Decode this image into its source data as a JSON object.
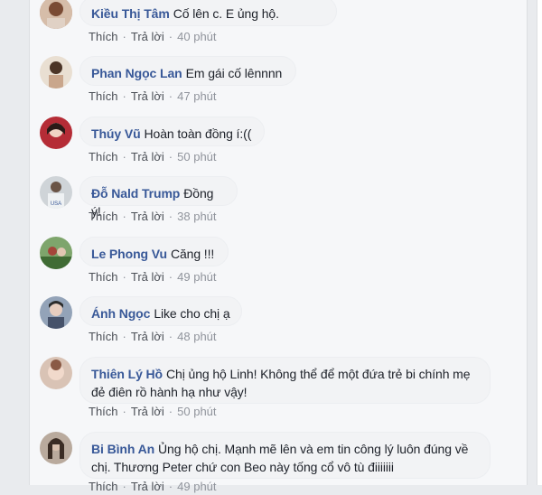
{
  "comments": [
    {
      "name": "Kiều Thị Tâm",
      "text": "Cố lên c. E ủng hộ.",
      "like": "Thích",
      "reply": "Trả lời",
      "time": "40 phút",
      "avatar_color": "#b7866d"
    },
    {
      "name": "Phan Ngọc Lan",
      "text": "Em gái cố lênnnn",
      "like": "Thích",
      "reply": "Trả lời",
      "time": "47 phút",
      "avatar_color": "#8b6a55"
    },
    {
      "name": "Thúy Vũ",
      "text": "Hoàn toàn đồng í:((",
      "like": "Thích",
      "reply": "Trả lời",
      "time": "50 phút",
      "avatar_color": "#a42b33"
    },
    {
      "name": "Đỗ Nald Trump",
      "text": "Đồng ý!",
      "like": "Thích",
      "reply": "Trả lời",
      "time": "38 phút",
      "avatar_color": "#6f7d88"
    },
    {
      "name": "Le Phong Vu",
      "text": "Căng !!!",
      "like": "Thích",
      "reply": "Trả lời",
      "time": "49 phút",
      "avatar_color": "#4e7a4a"
    },
    {
      "name": "Ánh Ngọc",
      "text": "Like cho chị ạ",
      "like": "Thích",
      "reply": "Trả lời",
      "time": "48 phút",
      "avatar_color": "#5c6b82"
    },
    {
      "name": "Thiên Lý Hồ",
      "text": "Chị ủng hộ Linh! Không thể để một đứa trẻ bi chính mẹ đẻ điên rồ hành hạ như vậy!",
      "like": "Thích",
      "reply": "Trả lời",
      "time": "50 phút",
      "avatar_color": "#c79a83"
    },
    {
      "name": "Bi Bình An",
      "text": "Ủng hộ chị. Mạnh mẽ lên và em tin công lý luôn đúng về chị. Thương Peter chứ con Beo này tống cổ vô tù điiiiiii",
      "like": "Thích",
      "reply": "Trả lời",
      "time": "49 phút",
      "avatar_color": "#7b6a5c"
    }
  ]
}
